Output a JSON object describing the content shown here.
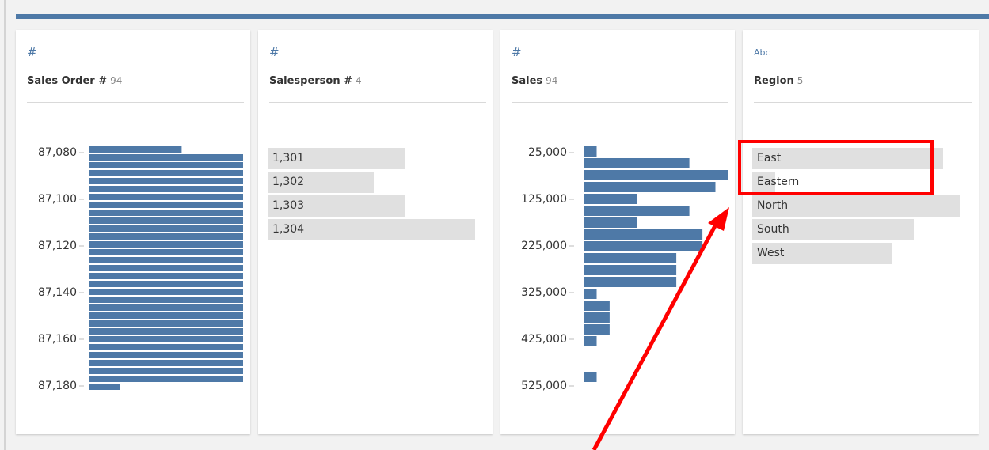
{
  "accent_color": "#4e79a7",
  "annotation_color": "#ff0000",
  "cards": [
    {
      "icon": "number-type-icon",
      "icon_glyph": "#",
      "name": "Sales Order #",
      "count": "94",
      "kind": "histogram",
      "axis_labels": [
        "87,080",
        "87,100",
        "87,120",
        "87,140",
        "87,160",
        "87,180"
      ],
      "bars": [
        0.6,
        1,
        1,
        1,
        1,
        1,
        1,
        1,
        1,
        1,
        1,
        1,
        1,
        1,
        1,
        1,
        1,
        1,
        1,
        1,
        1,
        1,
        1,
        1,
        1,
        1,
        1,
        1,
        1,
        1,
        0.2
      ]
    },
    {
      "icon": "number-type-icon",
      "icon_glyph": "#",
      "name": "Salesperson #",
      "count": "4",
      "kind": "categorical",
      "items": [
        {
          "label": "1,301",
          "fraction": 0.66
        },
        {
          "label": "1,302",
          "fraction": 0.51
        },
        {
          "label": "1,303",
          "fraction": 0.66
        },
        {
          "label": "1,304",
          "fraction": 1.0
        }
      ]
    },
    {
      "icon": "number-type-icon",
      "icon_glyph": "#",
      "name": "Sales",
      "count": "94",
      "kind": "histogram",
      "axis_labels": [
        "25,000",
        "125,000",
        "225,000",
        "325,000",
        "425,000",
        "525,000"
      ],
      "bars": [
        0.09,
        0.73,
        1,
        0.91,
        0.37,
        0.73,
        0.37,
        0.82,
        0.82,
        0.64,
        0.64,
        0.64,
        0.09,
        0.18,
        0.18,
        0.18,
        0.09,
        0,
        0,
        0.09
      ]
    },
    {
      "icon": "text-type-icon",
      "icon_glyph": "Abc",
      "name": "Region",
      "count": "5",
      "kind": "categorical",
      "items": [
        {
          "label": "East",
          "fraction": 0.92
        },
        {
          "label": "Eastern",
          "fraction": 0.11
        },
        {
          "label": "North",
          "fraction": 1.0
        },
        {
          "label": "South",
          "fraction": 0.78
        },
        {
          "label": "West",
          "fraction": 0.67
        }
      ]
    }
  ]
}
